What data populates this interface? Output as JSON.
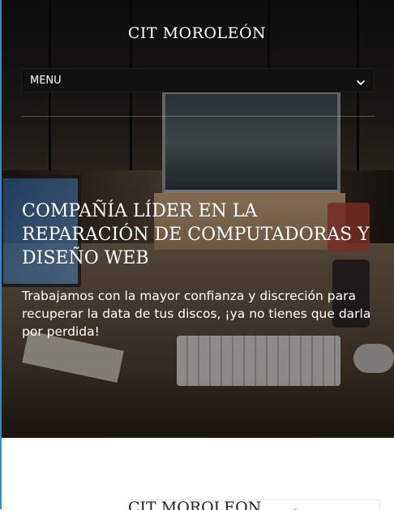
{
  "header": {
    "site_title": "CIT MOROLEÓN",
    "menu_label": "MENU"
  },
  "hero": {
    "heading": "COMPAÑÍA LÍDER EN LA REPARACIÓN DE COMPUTADORAS Y DISEÑO WEB",
    "text": "Trabajamos con la mayor confianza y discreción para recuperar la data de tus discos, ¡ya no tienes que darla por perdida!"
  },
  "footer_logo": {
    "text": "CIT MOROLEÓN"
  },
  "icons": {
    "menu_chevron": "chevron-down-icon"
  },
  "colors": {
    "accent_edge": "#2c8fd6",
    "menu_bg": "#111111",
    "text_light": "#ffffff"
  }
}
